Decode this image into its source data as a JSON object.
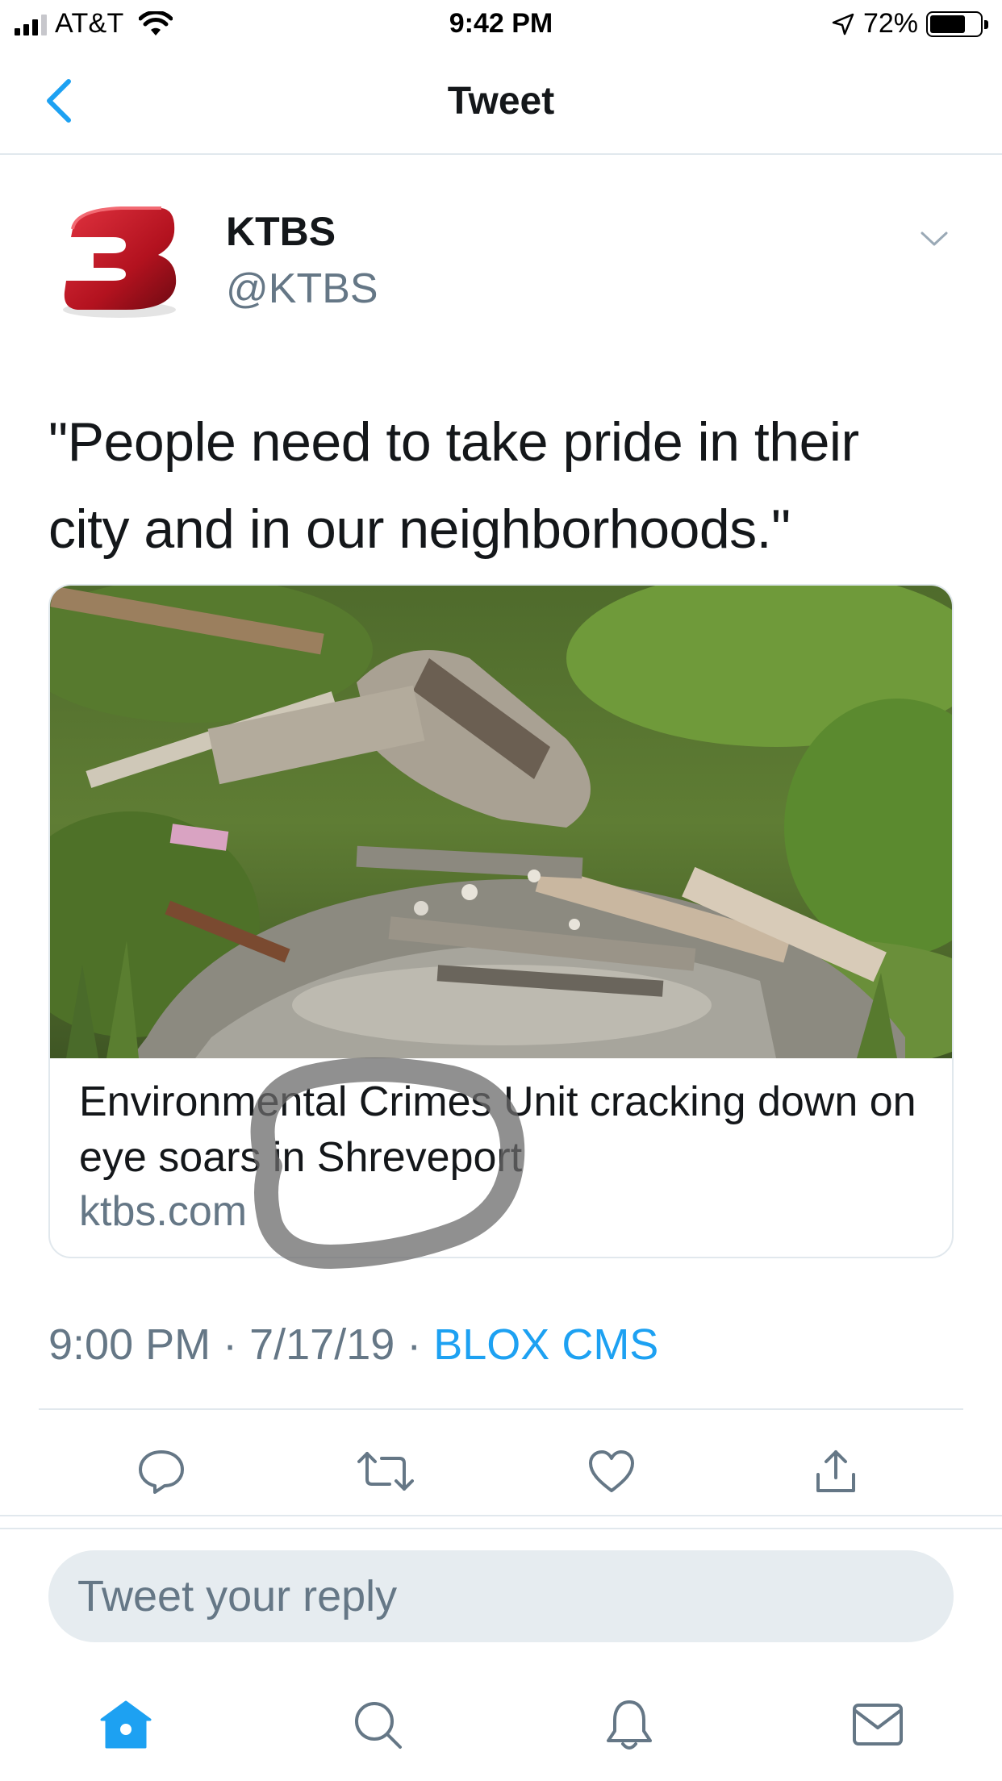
{
  "status_bar": {
    "carrier": "AT&T",
    "time": "9:42 PM",
    "battery": "72%",
    "battery_level": 0.72
  },
  "nav": {
    "title": "Tweet",
    "back_icon": "chevron-left-icon"
  },
  "tweet": {
    "author_name": "KTBS",
    "author_handle": "@KTBS",
    "text": "\"People need to take pride in their city and in our neighborhoods.\"",
    "card": {
      "title": "Environmental Crimes Unit cracking down on eye soars in Shreveport",
      "domain": "ktbs.com"
    },
    "timestamp": "9:00 PM · 7/17/19 · ",
    "source": "BLOX CMS"
  },
  "actions": {
    "reply_icon": "reply-icon",
    "retweet_icon": "retweet-icon",
    "like_icon": "heart-icon",
    "share_icon": "share-icon"
  },
  "reply": {
    "placeholder": "Tweet your reply"
  },
  "tab_bar": {
    "home_icon": "home-icon",
    "search_icon": "search-icon",
    "notifications_icon": "bell-icon",
    "messages_icon": "mail-icon"
  },
  "colors": {
    "accent": "#1da1f2",
    "secondary_text": "#657786",
    "border": "#e1e8ed",
    "reply_bg": "#e6ecf0",
    "logo_red": "#b3121f"
  }
}
